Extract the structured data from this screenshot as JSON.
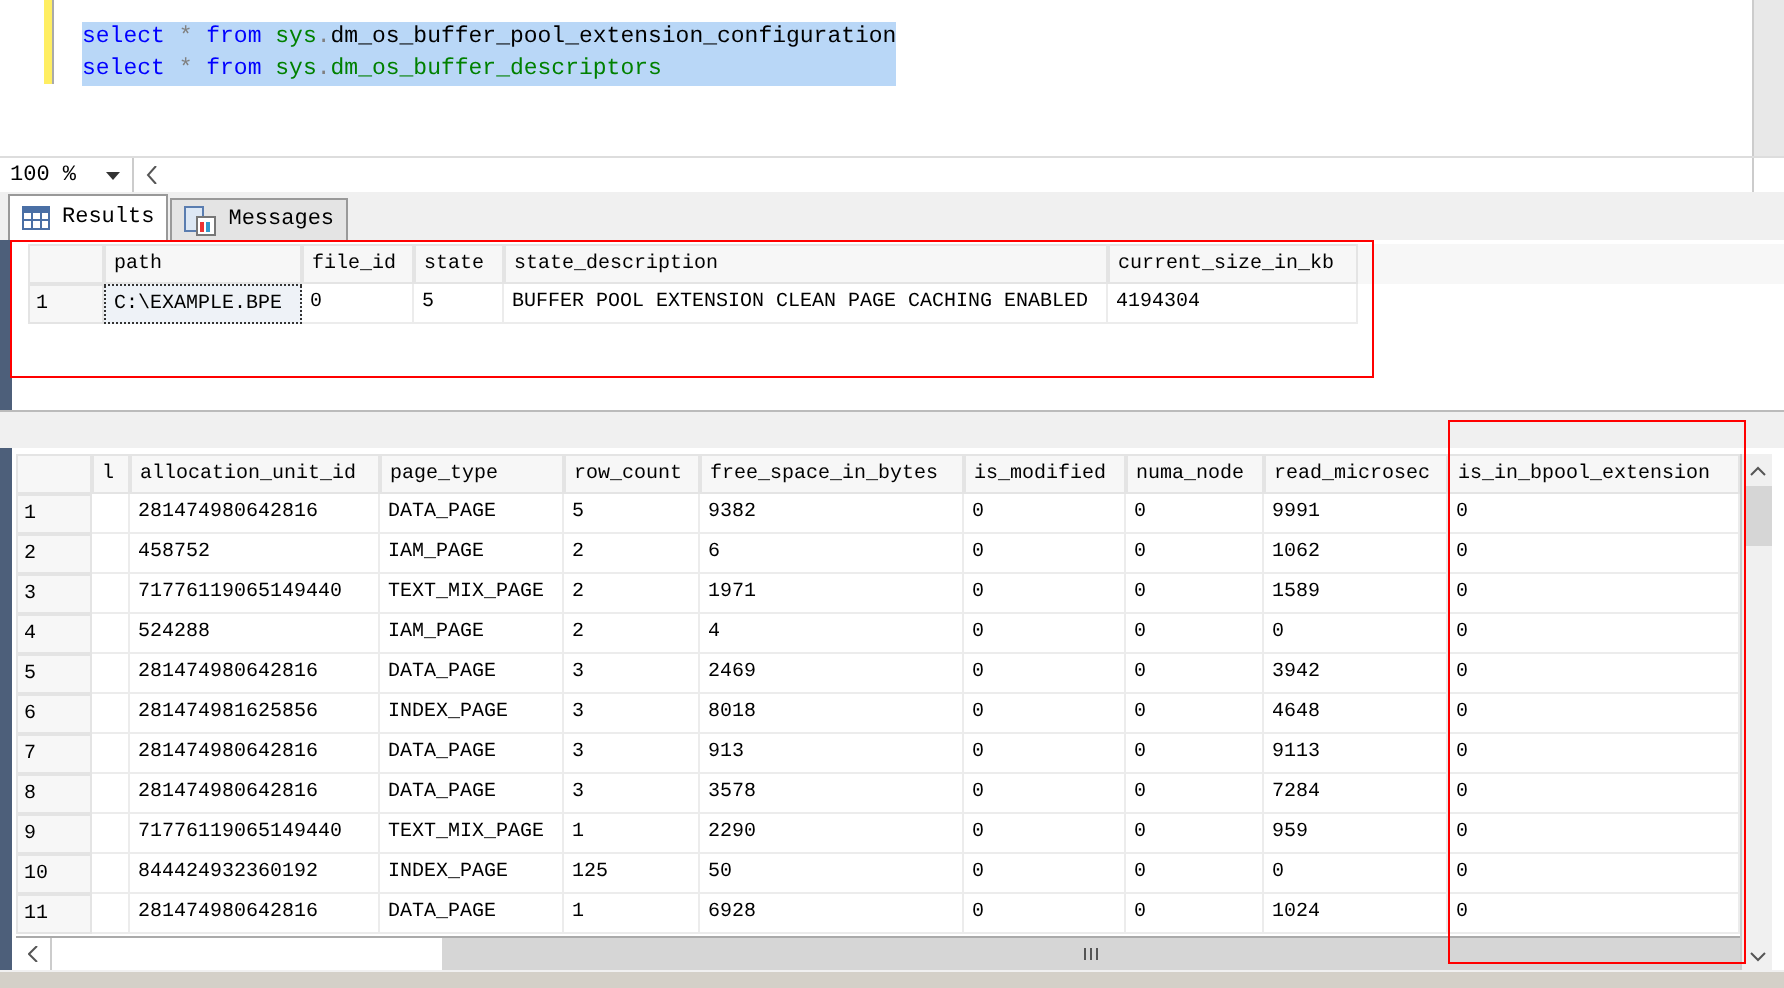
{
  "editor": {
    "lines": [
      {
        "selected": true,
        "tokens": [
          {
            "kind": "keyword",
            "text": "select "
          },
          {
            "kind": "operator",
            "text": "* "
          },
          {
            "kind": "keyword",
            "text": "from "
          },
          {
            "kind": "system",
            "text": "sys"
          },
          {
            "kind": "operator",
            "text": "."
          },
          {
            "kind": "plain",
            "text": "dm_os_buffer_pool_extension_configuration"
          }
        ]
      },
      {
        "selected": true,
        "tokens": [
          {
            "kind": "keyword",
            "text": "select "
          },
          {
            "kind": "operator",
            "text": "* "
          },
          {
            "kind": "keyword",
            "text": "from "
          },
          {
            "kind": "system",
            "text": "sys"
          },
          {
            "kind": "operator",
            "text": "."
          },
          {
            "kind": "system",
            "text": "dm_os_buffer_descriptors"
          }
        ]
      }
    ]
  },
  "zoom": "100 %",
  "tabs": [
    {
      "label": "Results",
      "kind": "grid",
      "selected": true
    },
    {
      "label": "Messages",
      "kind": "messages",
      "selected": false
    }
  ],
  "result_1": {
    "columns": [
      "path",
      "file_id",
      "state",
      "state_description",
      "current_size_in_kb"
    ],
    "rows": [
      {
        "number": "1",
        "cells": [
          {
            "text": "C:\\EXAMPLE.BPE",
            "focused": true
          },
          {
            "text": "0",
            "focused": false
          },
          {
            "text": "5",
            "focused": false
          },
          {
            "text": "BUFFER POOL EXTENSION CLEAN PAGE CACHING ENABLED",
            "focused": false
          },
          {
            "text": "4194304",
            "focused": false
          }
        ]
      }
    ]
  },
  "result_2": {
    "columns": [
      "l",
      "allocation_unit_id",
      "page_type",
      "row_count",
      "free_space_in_bytes",
      "is_modified",
      "numa_node",
      "read_microsec",
      "is_in_bpool_extension"
    ],
    "rows": [
      {
        "number": "1",
        "cells": [
          "",
          "281474980642816",
          "DATA_PAGE",
          "5",
          "9382",
          "0",
          "0",
          "9991",
          "0"
        ]
      },
      {
        "number": "2",
        "cells": [
          "",
          "458752",
          "IAM_PAGE",
          "2",
          "6",
          "0",
          "0",
          "1062",
          "0"
        ]
      },
      {
        "number": "3",
        "cells": [
          "",
          "71776119065149440",
          "TEXT_MIX_PAGE",
          "2",
          "1971",
          "0",
          "0",
          "1589",
          "0"
        ]
      },
      {
        "number": "4",
        "cells": [
          "",
          "524288",
          "IAM_PAGE",
          "2",
          "4",
          "0",
          "0",
          "0",
          "0"
        ]
      },
      {
        "number": "5",
        "cells": [
          "",
          "281474980642816",
          "DATA_PAGE",
          "3",
          "2469",
          "0",
          "0",
          "3942",
          "0"
        ]
      },
      {
        "number": "6",
        "cells": [
          "",
          "281474981625856",
          "INDEX_PAGE",
          "3",
          "8018",
          "0",
          "0",
          "4648",
          "0"
        ]
      },
      {
        "number": "7",
        "cells": [
          "",
          "281474980642816",
          "DATA_PAGE",
          "3",
          "913",
          "0",
          "0",
          "9113",
          "0"
        ]
      },
      {
        "number": "8",
        "cells": [
          "",
          "281474980642816",
          "DATA_PAGE",
          "3",
          "3578",
          "0",
          "0",
          "7284",
          "0"
        ]
      },
      {
        "number": "9",
        "cells": [
          "",
          "71776119065149440",
          "TEXT_MIX_PAGE",
          "1",
          "2290",
          "0",
          "0",
          "959",
          "0"
        ]
      },
      {
        "number": "10",
        "cells": [
          "",
          "844424932360192",
          "INDEX_PAGE",
          "125",
          "50",
          "0",
          "0",
          "0",
          "0"
        ]
      },
      {
        "number": "11",
        "cells": [
          "",
          "281474980642816",
          "DATA_PAGE",
          "1",
          "6928",
          "0",
          "0",
          "1024",
          "0"
        ]
      }
    ]
  }
}
